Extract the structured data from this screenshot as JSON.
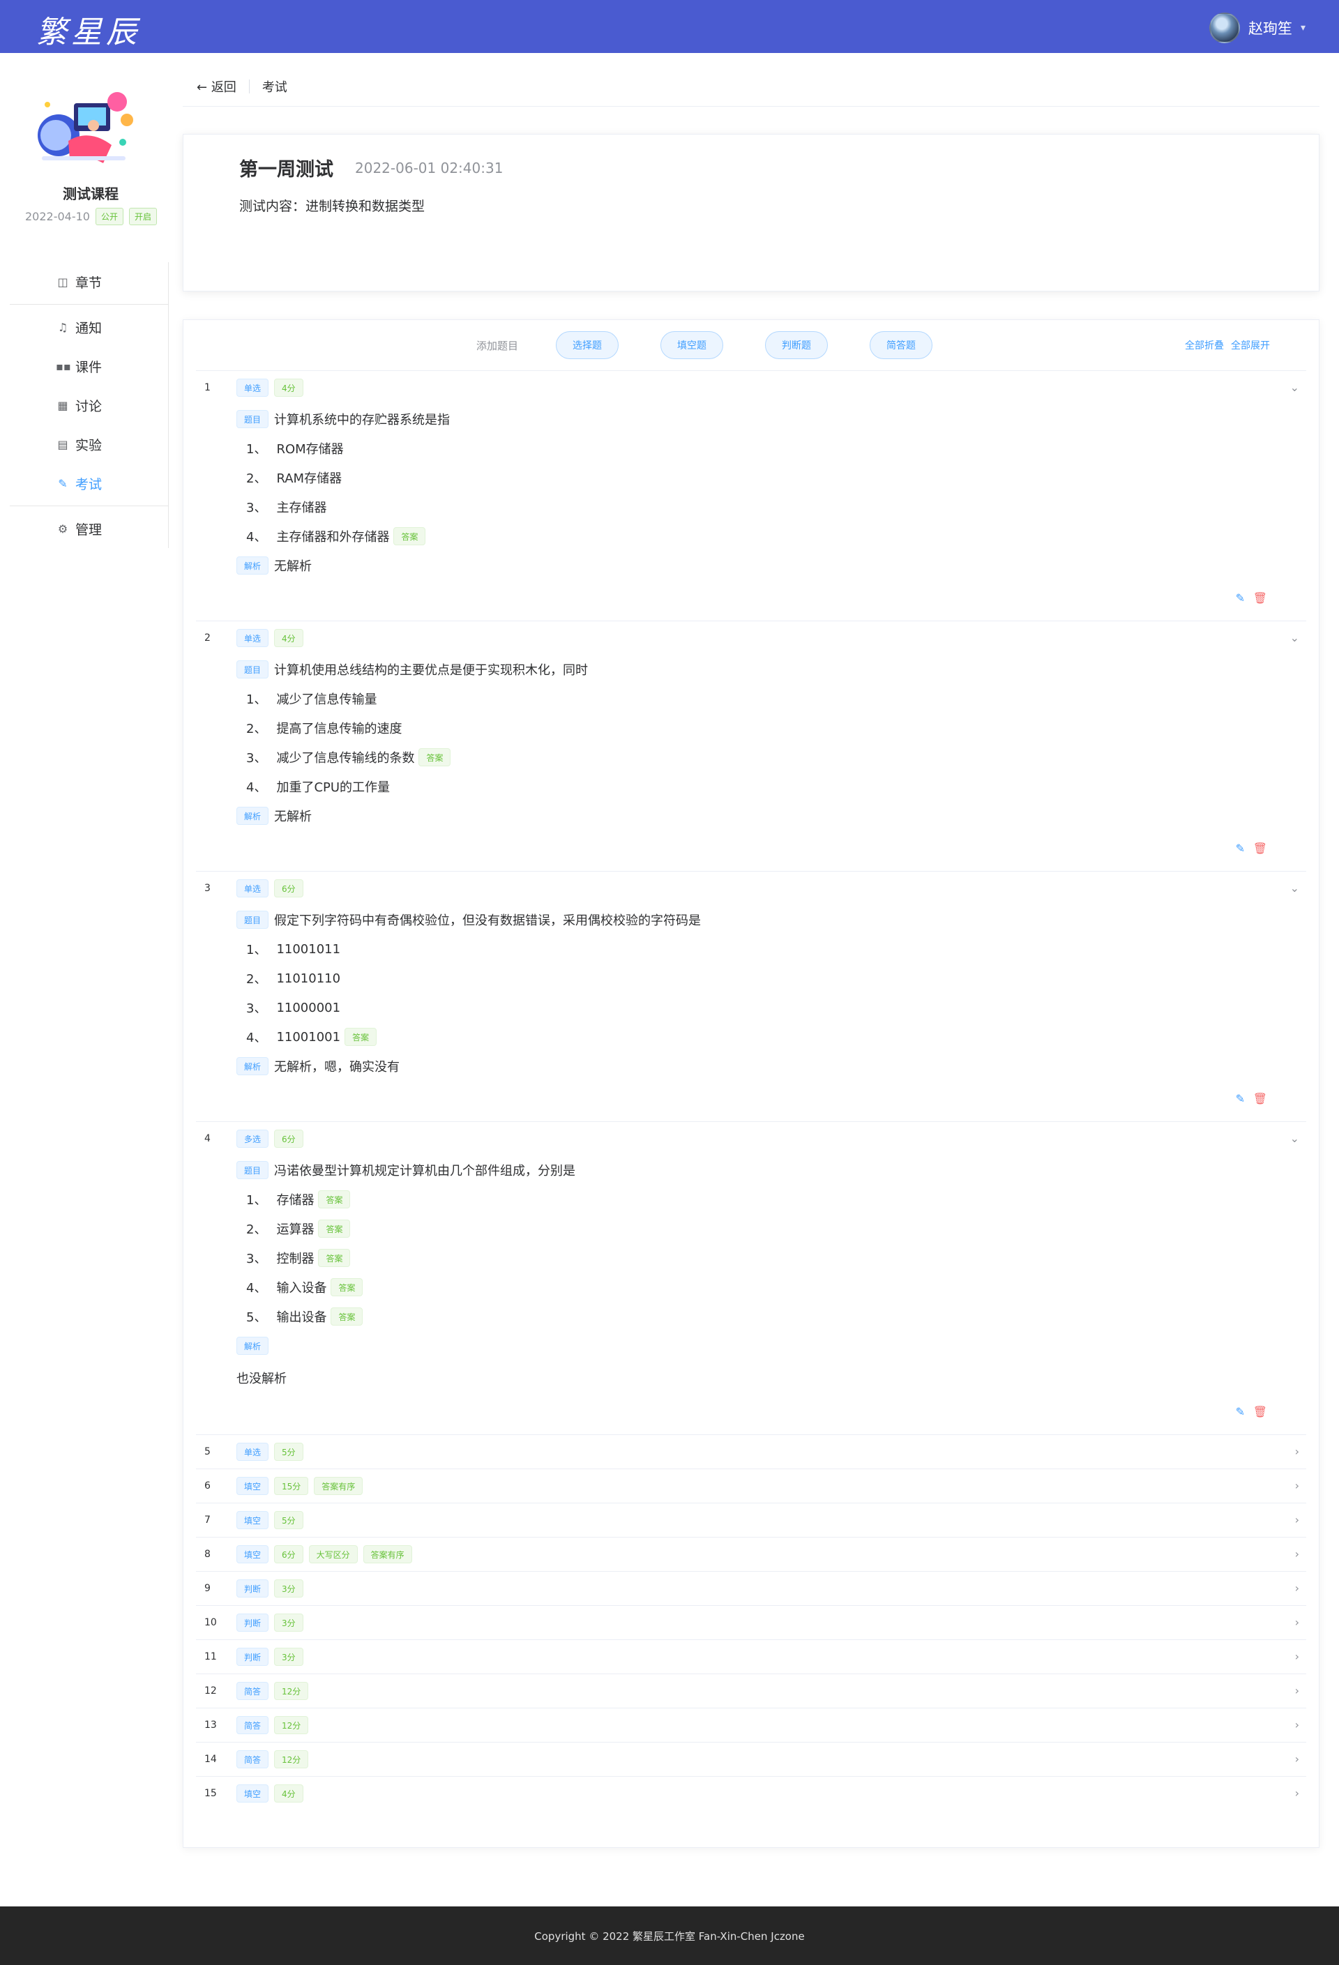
{
  "header": {
    "logo_text": "繁星辰",
    "user_name": "赵珣笙"
  },
  "course": {
    "name": "测试课程",
    "date": "2022-04-10",
    "tags": [
      "公开",
      "开启"
    ]
  },
  "menu": [
    {
      "label": "章节",
      "icon": "book-icon"
    },
    {
      "label": "通知",
      "icon": "bell-icon"
    },
    {
      "label": "课件",
      "icon": "grid-icon"
    },
    {
      "label": "讨论",
      "icon": "table-icon"
    },
    {
      "label": "实验",
      "icon": "document-icon"
    },
    {
      "label": "考试",
      "icon": "edit-icon",
      "active": true
    },
    {
      "label": "管理",
      "icon": "gear-icon"
    }
  ],
  "breadcrumb": {
    "back_label": "返回",
    "current": "考试"
  },
  "exam": {
    "title": "第一周测试",
    "time": "2022-06-01 02:40:31",
    "description": "测试内容：进制转换和数据类型"
  },
  "toolbar": {
    "add_label": "添加题目",
    "type_buttons": [
      "选择题",
      "填空题",
      "判断题",
      "简答题"
    ],
    "collapse_all": "全部折叠",
    "expand_all": "全部展开"
  },
  "labels": {
    "stem_tag": "题目",
    "analysis_tag": "解析",
    "answer_tag": "答案"
  },
  "questions": [
    {
      "index": "1",
      "type": "单选",
      "score": "4分",
      "extra_tags": [],
      "expanded": true,
      "stem": "计算机系统中的存贮器系统是指",
      "options": [
        {
          "num": "1、",
          "text": "ROM存储器",
          "answer": false
        },
        {
          "num": "2、",
          "text": "RAM存储器",
          "answer": false
        },
        {
          "num": "3、",
          "text": "主存储器",
          "answer": false
        },
        {
          "num": "4、",
          "text": "主存储器和外存储器",
          "answer": true
        }
      ],
      "analysis": "无解析"
    },
    {
      "index": "2",
      "type": "单选",
      "score": "4分",
      "extra_tags": [],
      "expanded": true,
      "stem": "计算机使用总线结构的主要优点是便于实现积木化，同时",
      "options": [
        {
          "num": "1、",
          "text": "减少了信息传输量",
          "answer": false
        },
        {
          "num": "2、",
          "text": "提高了信息传输的速度",
          "answer": false
        },
        {
          "num": "3、",
          "text": "减少了信息传输线的条数",
          "answer": true
        },
        {
          "num": "4、",
          "text": "加重了CPU的工作量",
          "answer": false
        }
      ],
      "analysis": "无解析"
    },
    {
      "index": "3",
      "type": "单选",
      "score": "6分",
      "extra_tags": [],
      "expanded": true,
      "stem": "假定下列字符码中有奇偶校验位，但没有数据错误，采用偶校校验的字符码是",
      "options": [
        {
          "num": "1、",
          "text": "11001011",
          "answer": false
        },
        {
          "num": "2、",
          "text": "11010110",
          "answer": false
        },
        {
          "num": "3、",
          "text": "11000001",
          "answer": false
        },
        {
          "num": "4、",
          "text": "11001001",
          "answer": true
        }
      ],
      "analysis": "无解析，嗯，确实没有"
    },
    {
      "index": "4",
      "type": "多选",
      "score": "6分",
      "extra_tags": [],
      "expanded": true,
      "stem": "冯诺依曼型计算机规定计算机由几个部件组成，分别是",
      "options": [
        {
          "num": "1、",
          "text": "存储器",
          "answer": true
        },
        {
          "num": "2、",
          "text": "运算器",
          "answer": true
        },
        {
          "num": "3、",
          "text": "控制器",
          "answer": true
        },
        {
          "num": "4、",
          "text": "输入设备",
          "answer": true
        },
        {
          "num": "5、",
          "text": "输出设备",
          "answer": true
        }
      ],
      "analysis": "",
      "analysis_block": "也没解析"
    },
    {
      "index": "5",
      "type": "单选",
      "score": "5分",
      "extra_tags": [],
      "expanded": false
    },
    {
      "index": "6",
      "type": "填空",
      "score": "15分",
      "extra_tags": [
        "答案有序"
      ],
      "expanded": false
    },
    {
      "index": "7",
      "type": "填空",
      "score": "5分",
      "extra_tags": [],
      "expanded": false
    },
    {
      "index": "8",
      "type": "填空",
      "score": "6分",
      "extra_tags": [
        "大写区分",
        "答案有序"
      ],
      "expanded": false
    },
    {
      "index": "9",
      "type": "判断",
      "score": "3分",
      "extra_tags": [],
      "expanded": false
    },
    {
      "index": "10",
      "type": "判断",
      "score": "3分",
      "extra_tags": [],
      "expanded": false
    },
    {
      "index": "11",
      "type": "判断",
      "score": "3分",
      "extra_tags": [],
      "expanded": false
    },
    {
      "index": "12",
      "type": "简答",
      "score": "12分",
      "extra_tags": [],
      "expanded": false
    },
    {
      "index": "13",
      "type": "简答",
      "score": "12分",
      "extra_tags": [],
      "expanded": false
    },
    {
      "index": "14",
      "type": "简答",
      "score": "12分",
      "extra_tags": [],
      "expanded": false
    },
    {
      "index": "15",
      "type": "填空",
      "score": "4分",
      "extra_tags": [],
      "expanded": false
    }
  ],
  "footer": {
    "copyright": "Copyright © 2022 繁星辰工作室 Fan-Xin-Chen Jczone"
  },
  "colors": {
    "header": "#4a5bd0",
    "accent": "#409eff",
    "success": "#67c23a",
    "danger": "#f56c6c",
    "footer": "#262626"
  }
}
